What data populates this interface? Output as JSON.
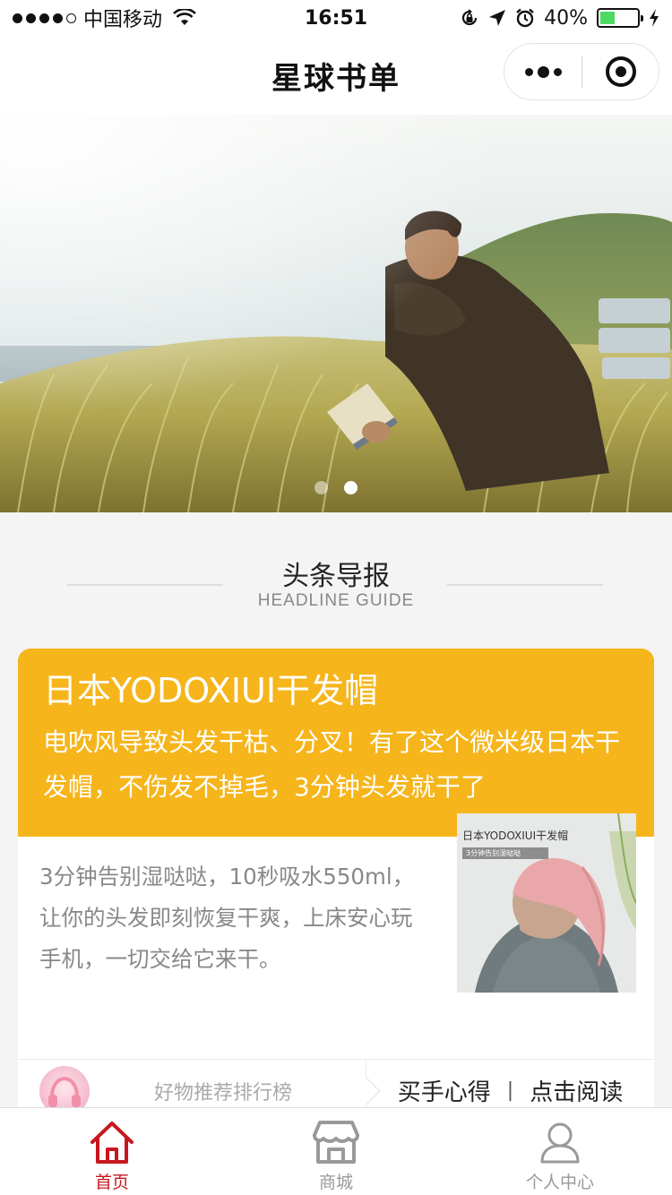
{
  "status_bar": {
    "carrier": "中国移动",
    "time": "16:51",
    "battery_percent": "40%",
    "battery_level": 0.4,
    "icons": [
      "signal-icon",
      "wifi-icon",
      "rotation-lock-icon",
      "location-icon",
      "alarm-icon",
      "battery-icon",
      "charging-icon"
    ]
  },
  "nav": {
    "title": "星球书单",
    "icons": [
      "more-icon",
      "close-miniprogram-icon"
    ]
  },
  "banner": {
    "slide_count": 2,
    "active_slide": 2,
    "image": "man-reading-book-in-grass-photo"
  },
  "section": {
    "title": "头条导报",
    "subtitle": "HEADLINE GUIDE"
  },
  "article": {
    "title": "日本YODOXIUI干发帽",
    "summary": "电吹风导致头发干枯、分叉！有了这个微米级日本干发帽，不伤发不掉毛，3分钟头发就干了",
    "description": "3分钟告别湿哒哒，10秒吸水550ml，让你的头发即刻恢复干爽，上床安心玩手机，一切交给它来干。",
    "thumbnail": {
      "title": "日本YODOXIUI干发帽",
      "tagline": "3分钟告别湿哒哒",
      "image": "woman-with-hair-towel-photo"
    },
    "header_color": "#f5b51b"
  },
  "footer_links": {
    "ranking_label": "好物推荐排行榜",
    "buy_tips_label": "买手心得",
    "separator": "|",
    "read_label": "点击阅读"
  },
  "tab_bar": {
    "items": [
      {
        "label": "首页",
        "icon": "home-icon",
        "active": true
      },
      {
        "label": "商城",
        "icon": "store-icon",
        "active": false
      },
      {
        "label": "个人中心",
        "icon": "user-icon",
        "active": false
      }
    ],
    "active_color": "#c8161e",
    "inactive_color": "#999999"
  }
}
